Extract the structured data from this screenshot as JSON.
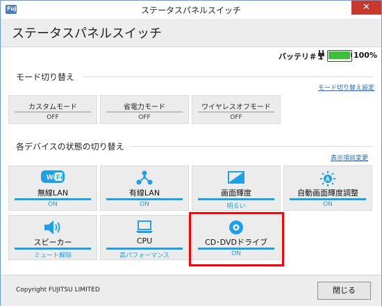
{
  "window": {
    "title": "ステータスパネルスイッチ",
    "close_glyph": "✕",
    "app_icon_text": "Fuj"
  },
  "header": {
    "title": "ステータスパネルスイッチ"
  },
  "battery": {
    "label": "バッテリ＃１",
    "percent": "100%",
    "level": 1.0
  },
  "mode_section": {
    "title": "モード切り替え",
    "settings_link": "モード切り替え設定",
    "buttons": [
      {
        "label": "カスタムモード",
        "state": "OFF"
      },
      {
        "label": "省電力モード",
        "state": "OFF"
      },
      {
        "label": "ワイヤレスオフモード",
        "state": "OFF"
      }
    ]
  },
  "device_section": {
    "title": "各デバイスの状態の切り替え",
    "display_link": "表示項目変更",
    "tiles": [
      {
        "label": "無線LAN",
        "state": "ON",
        "icon": "wifi-icon"
      },
      {
        "label": "有線LAN",
        "state": "ON",
        "icon": "network-icon"
      },
      {
        "label": "画面輝度",
        "state": "明るい",
        "icon": "brightness-icon"
      },
      {
        "label": "自動画面輝度調整",
        "state": "ON",
        "icon": "auto-brightness-icon"
      },
      {
        "label": "スピーカー",
        "state": "ミュート解除",
        "icon": "speaker-icon"
      },
      {
        "label": "CPU",
        "state": "高パフォーマンス",
        "icon": "cpu-icon"
      },
      {
        "label": "CD･DVDドライブ",
        "state": "ON",
        "icon": "disc-icon"
      }
    ]
  },
  "footer": {
    "copyright": "Copyright FUJITSU LIMITED",
    "close_label": "閉じる"
  },
  "colors": {
    "accent": "#1ea0e6",
    "highlight": "#ff0000",
    "battery_fill": "#3cc03c",
    "close_red": "#c7392e"
  }
}
